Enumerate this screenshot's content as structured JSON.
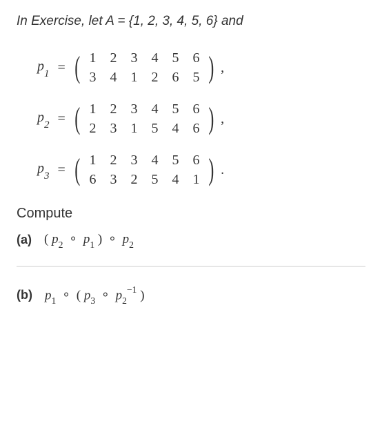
{
  "intro": "In Exercise, let A = {1, 2, 3, 4, 5, 6} and",
  "permutations": {
    "p1": {
      "name": "p",
      "subscript": "1",
      "eq": "=",
      "top": [
        "1",
        "2",
        "3",
        "4",
        "5",
        "6"
      ],
      "bottom": [
        "3",
        "4",
        "1",
        "2",
        "6",
        "5"
      ],
      "trail": ","
    },
    "p2": {
      "name": "p",
      "subscript": "2",
      "eq": "=",
      "top": [
        "1",
        "2",
        "3",
        "4",
        "5",
        "6"
      ],
      "bottom": [
        "2",
        "3",
        "1",
        "5",
        "4",
        "6"
      ],
      "trail": ","
    },
    "p3": {
      "name": "p",
      "subscript": "3",
      "eq": "=",
      "top": [
        "1",
        "2",
        "3",
        "4",
        "5",
        "6"
      ],
      "bottom": [
        "6",
        "3",
        "2",
        "5",
        "4",
        "1"
      ],
      "trail": "."
    }
  },
  "compute": "Compute",
  "parts": {
    "a": {
      "label": "(a)",
      "tokens": {
        "lp1": "(",
        "p2": "p",
        "s2": "2",
        "c1": "∘",
        "p1": "p",
        "s1": "1",
        "rp1": ")",
        "c2": "∘",
        "p2b": "p",
        "s2b": "2"
      }
    },
    "b": {
      "label": "(b)",
      "tokens": {
        "p1": "p",
        "s1": "1",
        "c1": "∘",
        "lp": "(",
        "p3": "p",
        "s3": "3",
        "c2": "∘",
        "p2": "p",
        "s2": "2",
        "inv": "−1",
        "rp": ")"
      }
    }
  },
  "parens": {
    "left": "(",
    "right": ")"
  }
}
